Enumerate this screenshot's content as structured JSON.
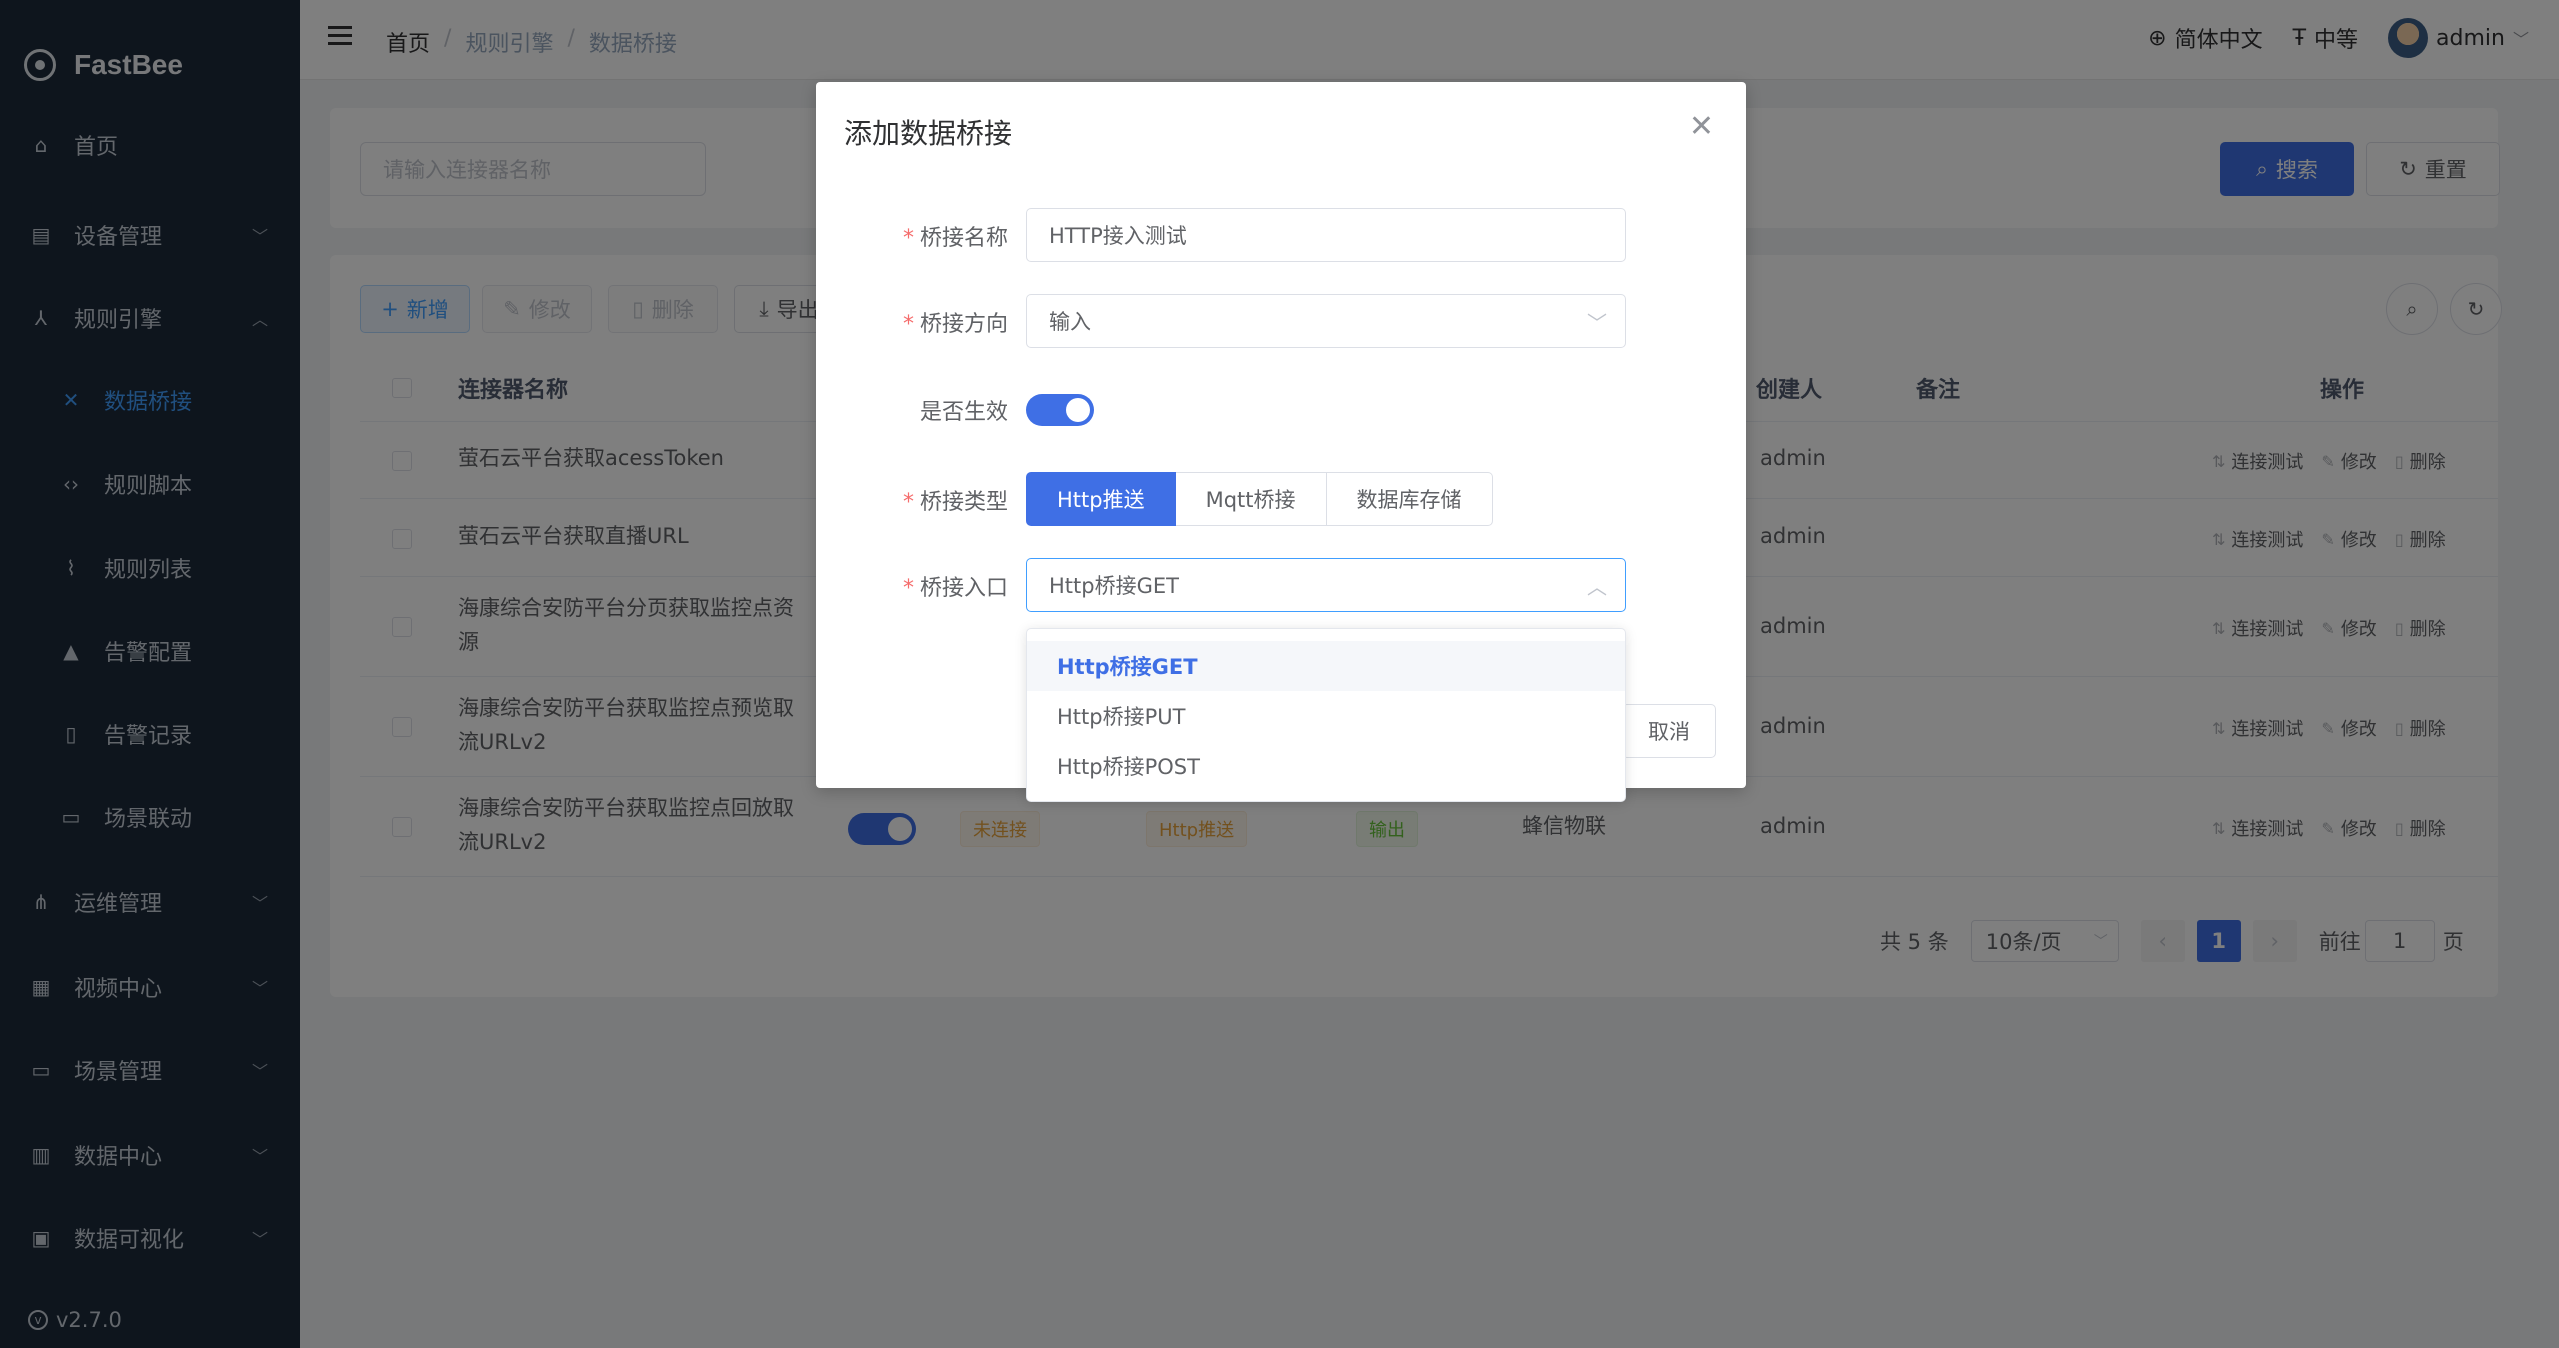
{
  "app": {
    "name": "FastBee",
    "version": "v2.7.0"
  },
  "sidebar": {
    "items": [
      {
        "label": "首页",
        "icon": "home-icon"
      },
      {
        "label": "设备管理",
        "icon": "device-icon",
        "expandable": true
      },
      {
        "label": "规则引擎",
        "icon": "rule-icon",
        "expandable": true,
        "expanded": true
      },
      {
        "label": "数据桥接",
        "icon": "bridge-icon",
        "active": true
      },
      {
        "label": "规则脚本",
        "icon": "code-icon"
      },
      {
        "label": "规则列表",
        "icon": "chart-line-icon"
      },
      {
        "label": "告警配置",
        "icon": "alarm-icon"
      },
      {
        "label": "告警记录",
        "icon": "record-icon"
      },
      {
        "label": "场景联动",
        "icon": "scene-icon"
      },
      {
        "label": "运维管理",
        "icon": "ops-icon",
        "expandable": true
      },
      {
        "label": "视频中心",
        "icon": "video-icon",
        "expandable": true
      },
      {
        "label": "场景管理",
        "icon": "scene-manage-icon",
        "expandable": true
      },
      {
        "label": "数据中心",
        "icon": "data-center-icon",
        "expandable": true
      },
      {
        "label": "数据可视化",
        "icon": "visualization-icon",
        "expandable": true
      }
    ]
  },
  "topbar": {
    "breadcrumb": [
      "首页",
      "规则引擎",
      "数据桥接"
    ],
    "separator": "/",
    "language": "简体中文",
    "font_size": "中等",
    "user": "admin"
  },
  "search": {
    "placeholder": "请输入连接器名称",
    "search_label": "搜索",
    "reset_label": "重置"
  },
  "toolbar": {
    "add_label": "新增",
    "edit_label": "修改",
    "delete_label": "删除",
    "export_label": "导出"
  },
  "table": {
    "headers": {
      "name": "连接器名称",
      "creator": "创建人",
      "remark": "备注",
      "ops": "操作"
    },
    "rows": [
      {
        "name": "萤石云平台获取acessToken",
        "creator": "admin"
      },
      {
        "name": "萤石云平台获取直播URL",
        "creator": "admin"
      },
      {
        "name": "海康综合安防平台分页获取监控点资源",
        "creator": "admin"
      },
      {
        "name": "海康综合安防平台获取监控点预览取流URLv2",
        "creator": "admin"
      },
      {
        "name": "海康综合安防平台获取监控点回放取流URLv2",
        "creator": "admin",
        "status": "未连接",
        "type": "Http推送",
        "direction": "输出",
        "owner": "蜂信物联"
      }
    ],
    "row_actions": {
      "test": "连接测试",
      "edit": "修改",
      "delete": "删除"
    }
  },
  "pagination": {
    "total": "共 5 条",
    "page_size": "10条/页",
    "current_page": "1",
    "goto_label": "前往",
    "goto_value": "1",
    "page_suffix": "页"
  },
  "dialog": {
    "title": "添加数据桥接",
    "fields": {
      "name": {
        "label": "桥接名称",
        "value": "HTTP接入测试"
      },
      "direction": {
        "label": "桥接方向",
        "value": "输入"
      },
      "enabled": {
        "label": "是否生效",
        "value": true
      },
      "type": {
        "label": "桥接类型",
        "options": [
          "Http推送",
          "Mqtt桥接",
          "数据库存储"
        ],
        "selected": "Http推送"
      },
      "entry": {
        "label": "桥接入口",
        "value": "Http桥接GET"
      }
    },
    "cancel_label": "取消",
    "dropdown_options": [
      "Http桥接GET",
      "Http桥接PUT",
      "Http桥接POST"
    ],
    "dropdown_selected": "Http桥接GET"
  },
  "colors": {
    "sidebar_bg": "#1d2b3a",
    "primary": "#3f6fe5",
    "active_nav": "#409eff"
  }
}
